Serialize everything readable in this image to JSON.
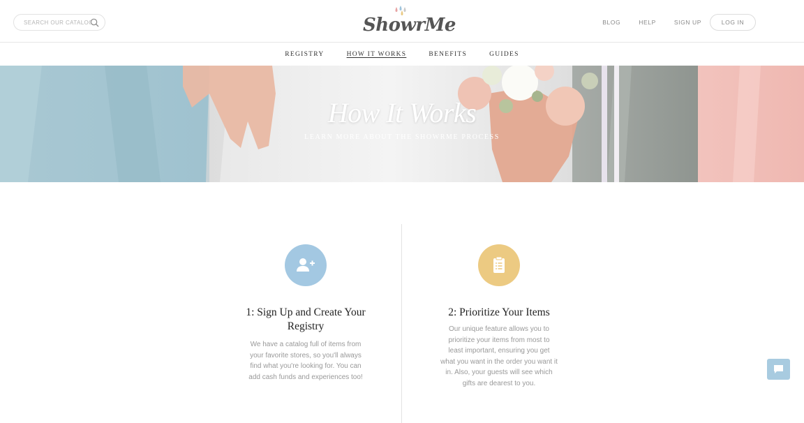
{
  "header": {
    "search": {
      "placeholder": "SEARCH OUR CATALOG",
      "icon": "search-icon"
    },
    "logo": {
      "text": "ShowrMe",
      "drop_colors": [
        "#e7a3a3",
        "#9ec3dc",
        "#c9c9c9",
        "#e9c983"
      ]
    },
    "nav": [
      {
        "label": "BLOG"
      },
      {
        "label": "HELP"
      },
      {
        "label": "SIGN UP"
      }
    ],
    "login_label": "LOG IN"
  },
  "subnav": {
    "items": [
      {
        "label": "REGISTRY",
        "active": false
      },
      {
        "label": "HOW IT WORKS",
        "active": true
      },
      {
        "label": "BENEFITS",
        "active": false
      },
      {
        "label": "GUIDES",
        "active": false
      }
    ]
  },
  "hero": {
    "title": "How It Works",
    "subtitle": "LEARN MORE ABOUT THE SHOWRME PROCESS"
  },
  "steps": [
    {
      "title": "1: Sign Up and Create Your Registry",
      "description": "We have a catalog full of items from your favorite stores, so you'll always find what you're looking for. You can add cash funds and experiences too!",
      "icon": "add-user-icon",
      "color": "#a3c8e2"
    },
    {
      "title": "2: Prioritize Your Items",
      "description": "Our unique feature allows you to prioritize your items from most to least important, ensuring you get what you want in the order you want it in. Also, your guests will see which gifts are dearest to you.",
      "icon": "clipboard-list-icon",
      "color": "#ecca82"
    }
  ],
  "chat": {
    "icon": "chat-bubble-icon",
    "color": "#a8cbe0"
  }
}
